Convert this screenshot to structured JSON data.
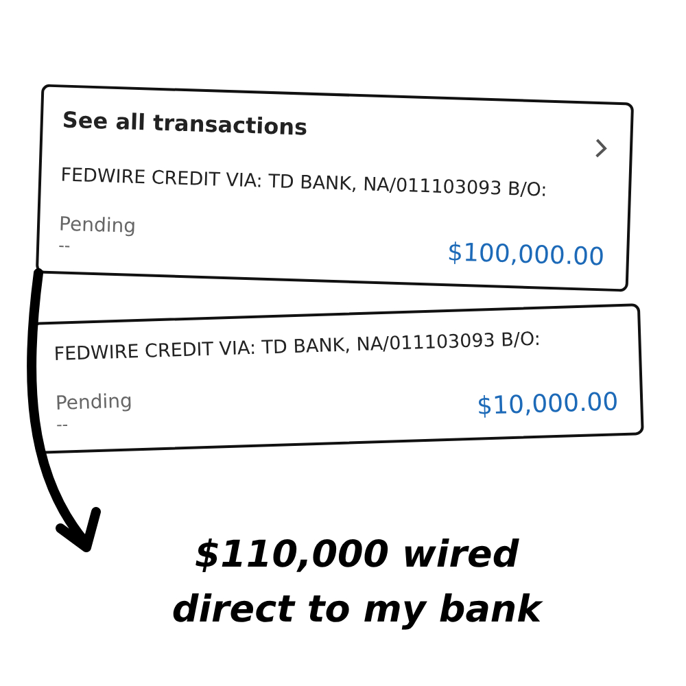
{
  "cards": [
    {
      "header": "See all transactions",
      "description": "FEDWIRE CREDIT VIA: TD BANK, NA/011103093 B/O:",
      "status": "Pending",
      "date": "--",
      "amount": "$100,000.00"
    },
    {
      "description": "FEDWIRE CREDIT VIA: TD BANK, NA/011103093 B/O:",
      "status": "Pending",
      "date": "--",
      "amount": "$10,000.00"
    }
  ],
  "caption": "$110,000 wired direct to my bank"
}
